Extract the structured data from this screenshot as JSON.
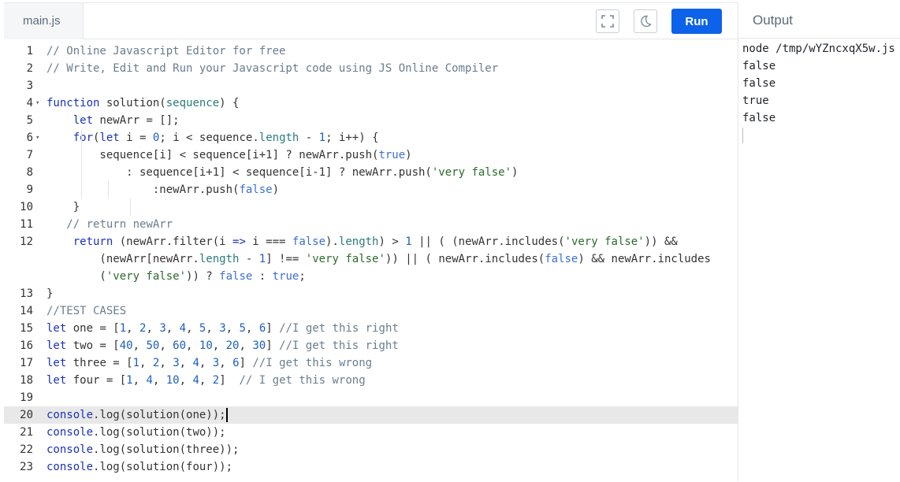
{
  "editor": {
    "file_tab": "main.js",
    "fullscreen_icon": "fullscreen-icon",
    "theme_icon": "moon-icon",
    "run_label": "Run",
    "active_line": 20,
    "lines": [
      {
        "num": "1",
        "fold": "",
        "tokens": [
          [
            "cm",
            "// Online Javascript Editor for free"
          ]
        ]
      },
      {
        "num": "2",
        "fold": "",
        "tokens": [
          [
            "cm",
            "// Write, Edit and Run your Javascript code using JS Online Compiler"
          ]
        ]
      },
      {
        "num": "3",
        "fold": "",
        "tokens": []
      },
      {
        "num": "4",
        "fold": "▾",
        "tokens": [
          [
            "kw",
            "function"
          ],
          [
            "op",
            " solution("
          ],
          [
            "pr",
            "sequence"
          ],
          [
            "op",
            ") {"
          ]
        ]
      },
      {
        "num": "5",
        "fold": "",
        "tokens": [
          [
            "op",
            "    "
          ],
          [
            "kw",
            "let"
          ],
          [
            "op",
            " newArr = [];"
          ]
        ]
      },
      {
        "num": "6",
        "fold": "▾",
        "tokens": [
          [
            "op",
            "    "
          ],
          [
            "kw",
            "for"
          ],
          [
            "op",
            "("
          ],
          [
            "kw",
            "let"
          ],
          [
            "op",
            " i = "
          ],
          [
            "nu",
            "0"
          ],
          [
            "op",
            "; i < sequence."
          ],
          [
            "pr",
            "length"
          ],
          [
            "op",
            " - "
          ],
          [
            "nu",
            "1"
          ],
          [
            "op",
            "; i++) {"
          ]
        ]
      },
      {
        "num": "7",
        "fold": "",
        "tokens": [
          [
            "op",
            "        sequence[i] < sequence[i+1] ? newArr.push("
          ],
          [
            "bo",
            "true"
          ],
          [
            "op",
            ")"
          ]
        ]
      },
      {
        "num": "8",
        "fold": "",
        "tokens": [
          [
            "op",
            "            : sequence[i+1] < sequence[i-1] ? newArr.push("
          ],
          [
            "st",
            "'very false'"
          ],
          [
            "op",
            ")"
          ]
        ]
      },
      {
        "num": "9",
        "fold": "",
        "tokens": [
          [
            "op",
            "                :newArr.push("
          ],
          [
            "bo",
            "false"
          ],
          [
            "op",
            ")"
          ]
        ]
      },
      {
        "num": "10",
        "fold": "",
        "tokens": [
          [
            "op",
            "    }"
          ]
        ]
      },
      {
        "num": "11",
        "fold": "",
        "tokens": [
          [
            "op",
            "   "
          ],
          [
            "cm",
            "// return newArr"
          ]
        ]
      },
      {
        "num": "12",
        "fold": "",
        "tokens": [
          [
            "op",
            "    "
          ],
          [
            "kw",
            "return"
          ],
          [
            "op",
            " (newArr.filter(i "
          ],
          [
            "kw",
            "=>"
          ],
          [
            "op",
            " i === "
          ],
          [
            "bo",
            "false"
          ],
          [
            "op",
            ")."
          ],
          [
            "pr",
            "length"
          ],
          [
            "op",
            ") > "
          ],
          [
            "nu",
            "1"
          ],
          [
            "op",
            " || ( (newArr.includes("
          ],
          [
            "st",
            "'very false'"
          ],
          [
            "op",
            ")) &&"
          ]
        ]
      },
      {
        "num": "",
        "fold": "",
        "tokens": [
          [
            "op",
            "        (newArr[newArr."
          ],
          [
            "pr",
            "length"
          ],
          [
            "op",
            " - "
          ],
          [
            "nu",
            "1"
          ],
          [
            "op",
            "] !== "
          ],
          [
            "st",
            "'very false'"
          ],
          [
            "op",
            ")) || ( newArr.includes("
          ],
          [
            "bo",
            "false"
          ],
          [
            "op",
            ") && newArr.includes"
          ]
        ]
      },
      {
        "num": "",
        "fold": "",
        "tokens": [
          [
            "op",
            "        ("
          ],
          [
            "st",
            "'very false'"
          ],
          [
            "op",
            ")) ? "
          ],
          [
            "bo",
            "false"
          ],
          [
            "op",
            " : "
          ],
          [
            "bo",
            "true"
          ],
          [
            "op",
            ";"
          ]
        ]
      },
      {
        "num": "13",
        "fold": "",
        "tokens": [
          [
            "op",
            "}"
          ]
        ]
      },
      {
        "num": "14",
        "fold": "",
        "tokens": [
          [
            "cm",
            "//TEST CASES"
          ]
        ]
      },
      {
        "num": "15",
        "fold": "",
        "tokens": [
          [
            "kw",
            "let"
          ],
          [
            "op",
            " one = ["
          ],
          [
            "nu",
            "1"
          ],
          [
            "op",
            ", "
          ],
          [
            "nu",
            "2"
          ],
          [
            "op",
            ", "
          ],
          [
            "nu",
            "3"
          ],
          [
            "op",
            ", "
          ],
          [
            "nu",
            "4"
          ],
          [
            "op",
            ", "
          ],
          [
            "nu",
            "5"
          ],
          [
            "op",
            ", "
          ],
          [
            "nu",
            "3"
          ],
          [
            "op",
            ", "
          ],
          [
            "nu",
            "5"
          ],
          [
            "op",
            ", "
          ],
          [
            "nu",
            "6"
          ],
          [
            "op",
            "] "
          ],
          [
            "cm",
            "//I get this right"
          ]
        ]
      },
      {
        "num": "16",
        "fold": "",
        "tokens": [
          [
            "kw",
            "let"
          ],
          [
            "op",
            " two = ["
          ],
          [
            "nu",
            "40"
          ],
          [
            "op",
            ", "
          ],
          [
            "nu",
            "50"
          ],
          [
            "op",
            ", "
          ],
          [
            "nu",
            "60"
          ],
          [
            "op",
            ", "
          ],
          [
            "nu",
            "10"
          ],
          [
            "op",
            ", "
          ],
          [
            "nu",
            "20"
          ],
          [
            "op",
            ", "
          ],
          [
            "nu",
            "30"
          ],
          [
            "op",
            "] "
          ],
          [
            "cm",
            "//I get this right"
          ]
        ]
      },
      {
        "num": "17",
        "fold": "",
        "tokens": [
          [
            "kw",
            "let"
          ],
          [
            "op",
            " three = ["
          ],
          [
            "nu",
            "1"
          ],
          [
            "op",
            ", "
          ],
          [
            "nu",
            "2"
          ],
          [
            "op",
            ", "
          ],
          [
            "nu",
            "3"
          ],
          [
            "op",
            ", "
          ],
          [
            "nu",
            "4"
          ],
          [
            "op",
            ", "
          ],
          [
            "nu",
            "3"
          ],
          [
            "op",
            ", "
          ],
          [
            "nu",
            "6"
          ],
          [
            "op",
            "] "
          ],
          [
            "cm",
            "//I get this wrong"
          ]
        ]
      },
      {
        "num": "18",
        "fold": "",
        "tokens": [
          [
            "kw",
            "let"
          ],
          [
            "op",
            " four = ["
          ],
          [
            "nu",
            "1"
          ],
          [
            "op",
            ", "
          ],
          [
            "nu",
            "4"
          ],
          [
            "op",
            ", "
          ],
          [
            "nu",
            "10"
          ],
          [
            "op",
            ", "
          ],
          [
            "nu",
            "4"
          ],
          [
            "op",
            ", "
          ],
          [
            "nu",
            "2"
          ],
          [
            "op",
            "]  "
          ],
          [
            "cm",
            "// I get this wrong"
          ]
        ]
      },
      {
        "num": "19",
        "fold": "",
        "tokens": []
      },
      {
        "num": "20",
        "fold": "",
        "tokens": [
          [
            "kw",
            "console"
          ],
          [
            "op",
            ".log(solution(one));"
          ]
        ]
      },
      {
        "num": "21",
        "fold": "",
        "tokens": [
          [
            "kw",
            "console"
          ],
          [
            "op",
            ".log(solution(two));"
          ]
        ]
      },
      {
        "num": "22",
        "fold": "",
        "tokens": [
          [
            "kw",
            "console"
          ],
          [
            "op",
            ".log(solution(three));"
          ]
        ]
      },
      {
        "num": "23",
        "fold": "",
        "tokens": [
          [
            "kw",
            "console"
          ],
          [
            "op",
            ".log(solution(four));"
          ]
        ]
      }
    ]
  },
  "output": {
    "title": "Output",
    "lines": [
      "node /tmp/wYZncxqX5w.js",
      "false",
      "false",
      "true",
      "false"
    ]
  },
  "colors": {
    "run_button": "#0c62e8",
    "keyword": "#1a32b8",
    "comment": "#6a7d8e",
    "number": "#1c5fc0",
    "string": "#2b6b2b",
    "active_line": "#e8e8e8"
  }
}
